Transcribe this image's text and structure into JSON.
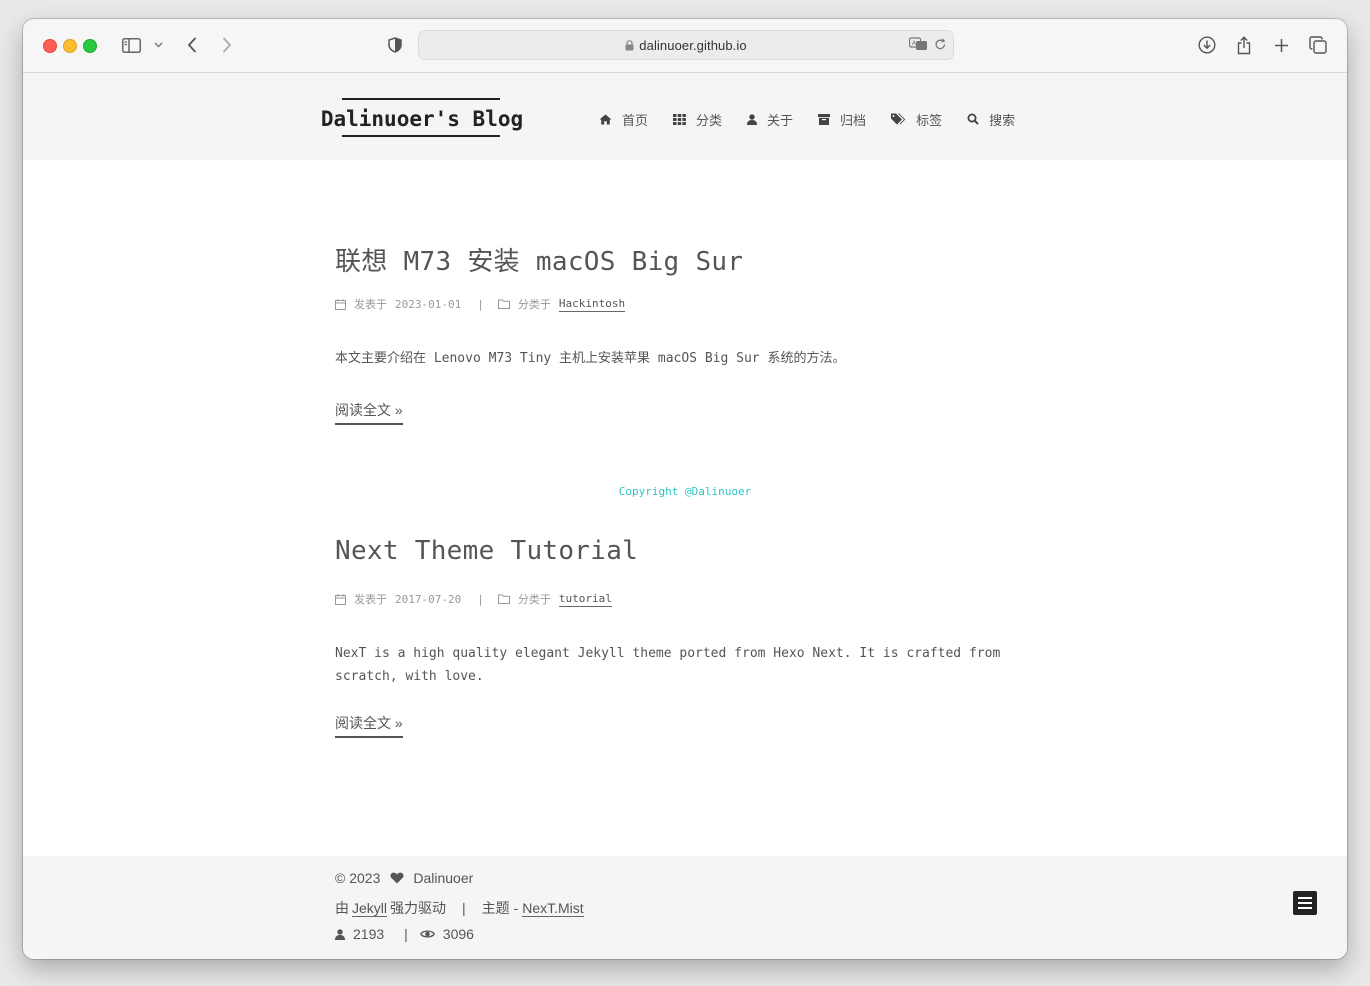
{
  "browser": {
    "url": "dalinuoer.github.io"
  },
  "site": {
    "title": "Dalinuoer's Blog",
    "menu": [
      {
        "label": "首页",
        "icon": "home-icon"
      },
      {
        "label": "分类",
        "icon": "grid-icon"
      },
      {
        "label": "关于",
        "icon": "user-icon"
      },
      {
        "label": "归档",
        "icon": "archive-icon"
      },
      {
        "label": "标签",
        "icon": "tags-icon"
      },
      {
        "label": "搜索",
        "icon": "search-icon"
      }
    ]
  },
  "posts": [
    {
      "title": "联想 M73 安装 macOS Big Sur",
      "posted_label": "发表于",
      "date": "2023-01-01",
      "category_label": "分类于",
      "category": "Hackintosh",
      "excerpt": "本文主要介绍在 Lenovo M73 Tiny 主机上安装苹果 macOS Big Sur 系统的方法。",
      "read_more": "阅读全文 »"
    },
    {
      "title": "Next Theme Tutorial",
      "posted_label": "发表于",
      "date": "2017-07-20",
      "category_label": "分类于",
      "category": "tutorial",
      "excerpt": "NexT is a high quality elegant Jekyll theme ported from Hexo Next. It is crafted from scratch, with love.",
      "read_more": "阅读全文 »"
    }
  ],
  "copyright_text": "Copyright @Dalinuoer",
  "footer": {
    "year": "© 2023",
    "author": "Dalinuoer",
    "powered_prefix": "由",
    "powered_link": "Jekyll",
    "powered_suffix": "强力驱动",
    "theme_prefix": "主题 -",
    "theme_link": "NexT.Mist",
    "visitors": "2193",
    "views": "3096"
  },
  "colors": {
    "accent": "#2fc4c4",
    "text": "#555555",
    "header_bg": "#f5f5f5"
  }
}
